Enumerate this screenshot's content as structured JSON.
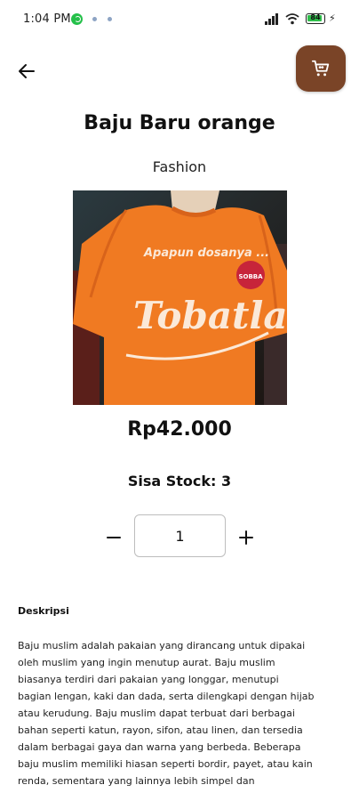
{
  "status_bar": {
    "time": "1:04 PM",
    "battery": "84",
    "battery_level": 0.84,
    "accent": "#25c04a"
  },
  "header": {
    "back_icon": "arrow-left-icon",
    "cart_icon": "shopping-cart-icon",
    "cart_button_color": "#7a4427"
  },
  "product": {
    "title": "Baju Baru orange",
    "category": "Fashion",
    "image_shirt_color": "#f07a22",
    "image_text_top": "Apapun dosanya ...",
    "image_text_main": "Tobatlah",
    "image_badge": "SOBBA",
    "price": "Rp42.000",
    "stock": "Sisa Stock: 3"
  },
  "quantity": {
    "minus_icon": "minus-icon",
    "value": "1",
    "plus_icon": "plus-icon"
  },
  "description": {
    "label": "Deskripsi",
    "text": "Baju muslim adalah pakaian yang dirancang untuk dipakai oleh muslim yang ingin menutup aurat. Baju muslim biasanya terdiri dari pakaian yang longgar, menutupi bagian lengan, kaki dan dada, serta dilengkapi dengan hijab atau kerudung. Baju muslim dapat terbuat dari berbagai bahan seperti katun, rayon, sifon, atau linen, dan tersedia dalam berbagai gaya dan warna yang berbeda. Beberapa baju muslim memiliki hiasan seperti bordir, payet, atau kain renda, sementara yang lainnya lebih simpel dan"
  }
}
